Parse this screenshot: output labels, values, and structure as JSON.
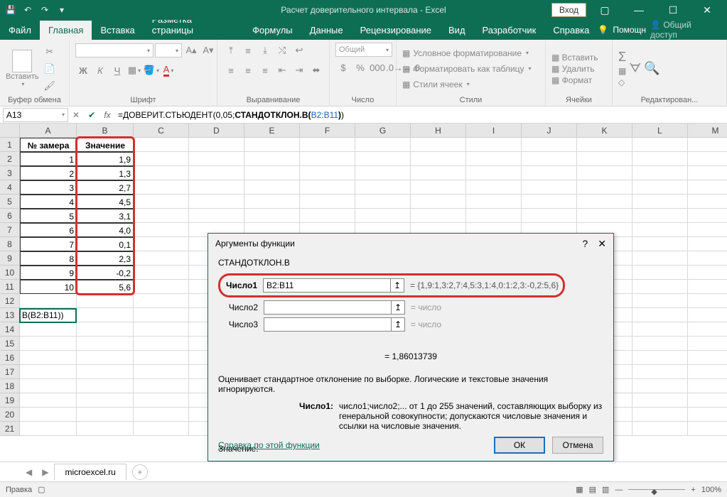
{
  "titlebar": {
    "title": "Расчет доверительного интервала - Excel",
    "login": "Вход"
  },
  "tabs": [
    "Файл",
    "Главная",
    "Вставка",
    "Разметка страницы",
    "Формулы",
    "Данные",
    "Рецензирование",
    "Вид",
    "Разработчик",
    "Справка"
  ],
  "active_tab": 1,
  "tell_me": "Помощн",
  "share": "Общий доступ",
  "ribbon": {
    "clipboard": {
      "label": "Буфер обмена",
      "paste": "Вставить"
    },
    "font": {
      "label": "Шрифт"
    },
    "align": {
      "label": "Выравнивание"
    },
    "number": {
      "label": "Число",
      "format": "Общий"
    },
    "styles": {
      "label": "Стили",
      "cond": "Условное форматирование",
      "table": "Форматировать как таблицу",
      "cell": "Стили ячеек"
    },
    "cells": {
      "label": "Ячейки",
      "insert": "Вставить",
      "delete": "Удалить",
      "format": "Формат"
    },
    "editing": {
      "label": "Редактирован..."
    }
  },
  "namebox": "A13",
  "formula_prefix": "=ДОВЕРИТ.СТЬЮДЕНТ(0,05;",
  "formula_bold": "СТАНДОТКЛОН.В(",
  "formula_range": "B2:B11",
  "formula_close": "))",
  "columns": [
    "A",
    "B",
    "C",
    "D",
    "E",
    "F",
    "G",
    "H",
    "I",
    "J",
    "K",
    "L",
    "M"
  ],
  "header_row": {
    "a": "№ замера",
    "b": "Значение"
  },
  "rows": [
    {
      "n": "1",
      "v": "1,9"
    },
    {
      "n": "2",
      "v": "1,3"
    },
    {
      "n": "3",
      "v": "2,7"
    },
    {
      "n": "4",
      "v": "4,5"
    },
    {
      "n": "5",
      "v": "3,1"
    },
    {
      "n": "6",
      "v": "4,0"
    },
    {
      "n": "7",
      "v": "0,1"
    },
    {
      "n": "8",
      "v": "2,3"
    },
    {
      "n": "9",
      "v": "-0,2"
    },
    {
      "n": "10",
      "v": "5,6"
    }
  ],
  "a13_cell": "В(B2:B11))",
  "sheet": "microexcel.ru",
  "status": {
    "ready": "Правка",
    "zoom": "100%"
  },
  "dialog": {
    "title": "Аргументы функции",
    "func": "СТАНДОТКЛОН.В",
    "args": [
      {
        "name": "Число1",
        "val": "B2:B11",
        "bold": true,
        "res": "= {1,9:1,3:2,7:4,5:3,1:4,0:1:2,3:-0,2:5,6}"
      },
      {
        "name": "Число2",
        "val": "",
        "bold": false,
        "res": "= число"
      },
      {
        "name": "Число3",
        "val": "",
        "bold": false,
        "res": "= число"
      }
    ],
    "result_eq": "= 1,86013739",
    "desc": "Оценивает стандартное отклонение по выборке. Логические и текстовые значения игнорируются.",
    "arg_label": "Число1:",
    "arg_desc": "число1;число2;... от 1 до 255 значений, составляющих выборку из генеральной совокупности; допускаются числовые значения и ссылки на числовые значения.",
    "value_label": "Значение:",
    "help": "Справка по этой функции",
    "ok": "ОК",
    "cancel": "Отмена"
  }
}
